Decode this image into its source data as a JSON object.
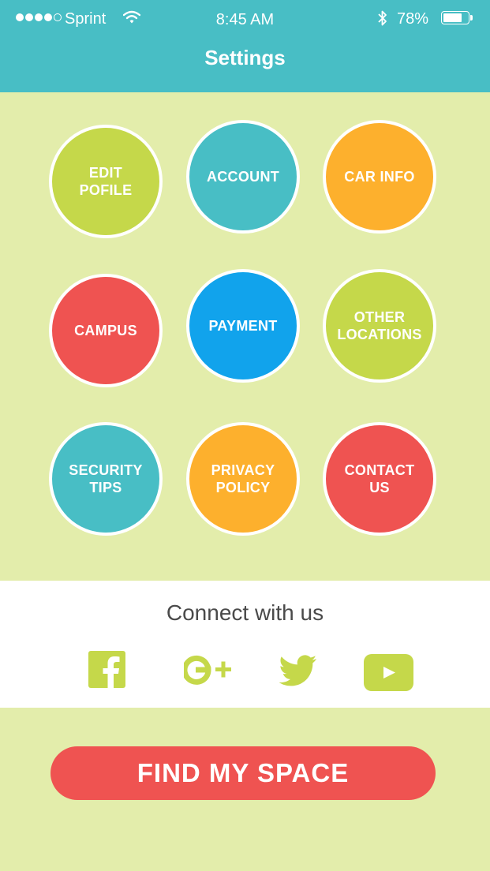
{
  "status_bar": {
    "carrier": "Sprint",
    "time": "8:45 AM",
    "battery_percent": "78%",
    "battery_level": 0.78,
    "signal_bars_filled": 4,
    "signal_bars_total": 5
  },
  "header": {
    "title": "Settings"
  },
  "menu": [
    {
      "label": "EDIT POFILE",
      "color": "#c5d84a"
    },
    {
      "label": "ACCOUNT",
      "color": "#48bec5"
    },
    {
      "label": "CAR INFO",
      "color": "#fdb02d"
    },
    {
      "label": "CAMPUS",
      "color": "#ef5351"
    },
    {
      "label": "PAYMENT",
      "color": "#11a3ec"
    },
    {
      "label": "OTHER LOCATIONS",
      "color": "#c5d84a"
    },
    {
      "label": "SECURITY TIPS",
      "color": "#48bec5"
    },
    {
      "label": "PRIVACY POLICY",
      "color": "#fdb02d"
    },
    {
      "label": "CONTACT US",
      "color": "#ef5351"
    }
  ],
  "connect": {
    "title": "Connect with us",
    "icons": [
      "facebook-icon",
      "google-plus-icon",
      "twitter-icon",
      "youtube-icon"
    ],
    "icon_color": "#c5d84a"
  },
  "cta": {
    "label": "FIND MY SPACE",
    "color": "#ef5351"
  },
  "colors": {
    "header": "#48bec5",
    "background": "#e3edab"
  }
}
